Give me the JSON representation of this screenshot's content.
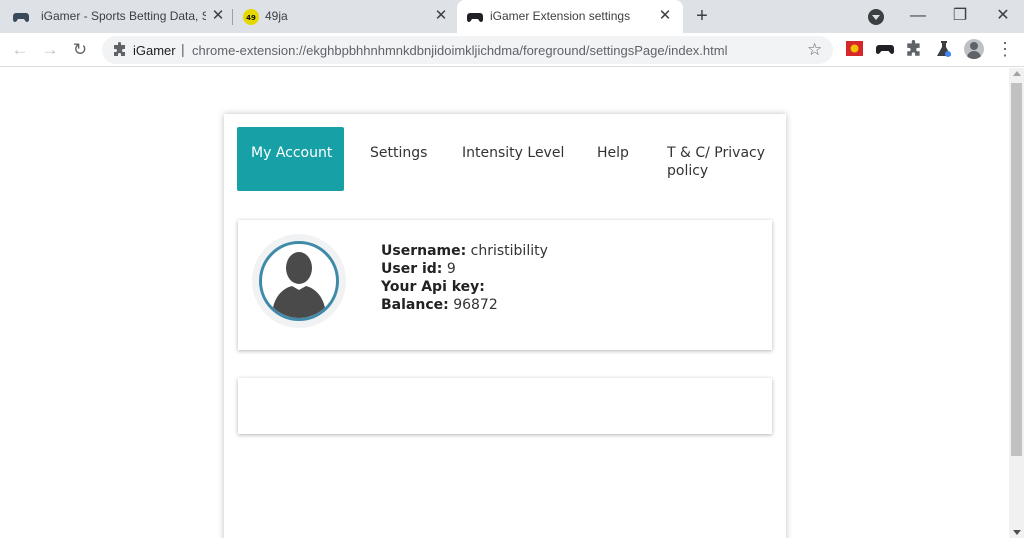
{
  "browser": {
    "tabs": [
      {
        "title": "iGamer - Sports Betting Data, Sta",
        "icon": "gamepad-icon",
        "active": false
      },
      {
        "title": "49ja",
        "icon": "49ja-logo-icon",
        "active": false
      },
      {
        "title": "iGamer Extension settings",
        "icon": "gamepad-icon",
        "active": true
      }
    ],
    "toolbar": {
      "site_name": "iGamer",
      "separator": "|",
      "url": "chrome-extension://ekghbpbhhnhmnkdbnjidoimkljichdma/foreground/settingsPage/index.html"
    },
    "extensions": [
      "red-flag-extension-icon",
      "gamepad-extension-icon",
      "puzzle-extensions-icon",
      "flask-extension-icon"
    ]
  },
  "page": {
    "nav_tabs": [
      {
        "label": "My Account",
        "active": true
      },
      {
        "label": "Settings",
        "active": false
      },
      {
        "label": "Intensity Level",
        "active": false
      },
      {
        "label": "Help",
        "active": false
      },
      {
        "label": "T & C/ Privacy policy",
        "active": false
      }
    ],
    "account": {
      "username_label": "Username:",
      "username": "christibility",
      "user_id_label": "User id:",
      "user_id": "9",
      "api_key_label": "Your Api key:",
      "api_key": "",
      "balance_label": "Balance:",
      "balance": "96872"
    }
  },
  "colors": {
    "accent": "#17a0a6",
    "avatar_ring": "#3f8aa8",
    "tab_strip": "#dee1e6"
  }
}
